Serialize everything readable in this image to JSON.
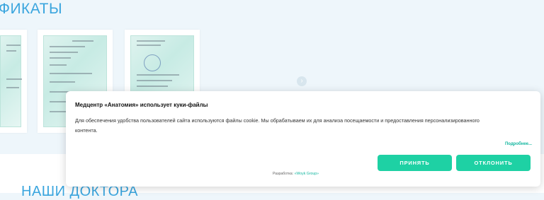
{
  "page": {
    "section_title": "ФИКАТЫ",
    "doctors_title": "НАШИ ДОКТОРА"
  },
  "certificates": [
    {
      "name": "certificate-1"
    },
    {
      "name": "certificate-2"
    },
    {
      "name": "certificate-3"
    }
  ],
  "cookie_banner": {
    "title": "Медцентр «Анатомия» использует куки-файлы",
    "text": "Для обеспечения удобства пользователей сайта используются файлы cookie. Мы обрабатываем их для анализа посещаемости и предоставления персонализированного контента.",
    "more_link": "Подробнее...",
    "accept_label": "ПРИНЯТЬ",
    "decline_label": "ОТКЛОНИТЬ",
    "developer_prefix": "Разработка: ",
    "developer_name": "«Woyk Group»"
  },
  "colors": {
    "accent": "#1ed1a4",
    "title_blue": "#3aa5de",
    "background": "#eef6fb"
  }
}
